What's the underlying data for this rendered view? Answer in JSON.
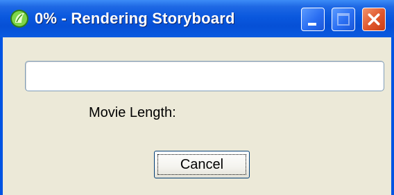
{
  "window": {
    "title": "0% - Rendering Storyboard",
    "icon": "app-leaf-icon",
    "controls": {
      "minimize_icon": "minimize-icon",
      "maximize_icon": "maximize-icon",
      "close_icon": "close-icon"
    }
  },
  "dialog": {
    "progress": {
      "percent": 0,
      "color": "#2fbf2f"
    },
    "movie_length_label": "Movie Length:",
    "cancel_label": "Cancel"
  },
  "colors": {
    "titlebar": "#0a58de",
    "client_bg": "#ece9d8",
    "close_button": "#e0562b"
  }
}
